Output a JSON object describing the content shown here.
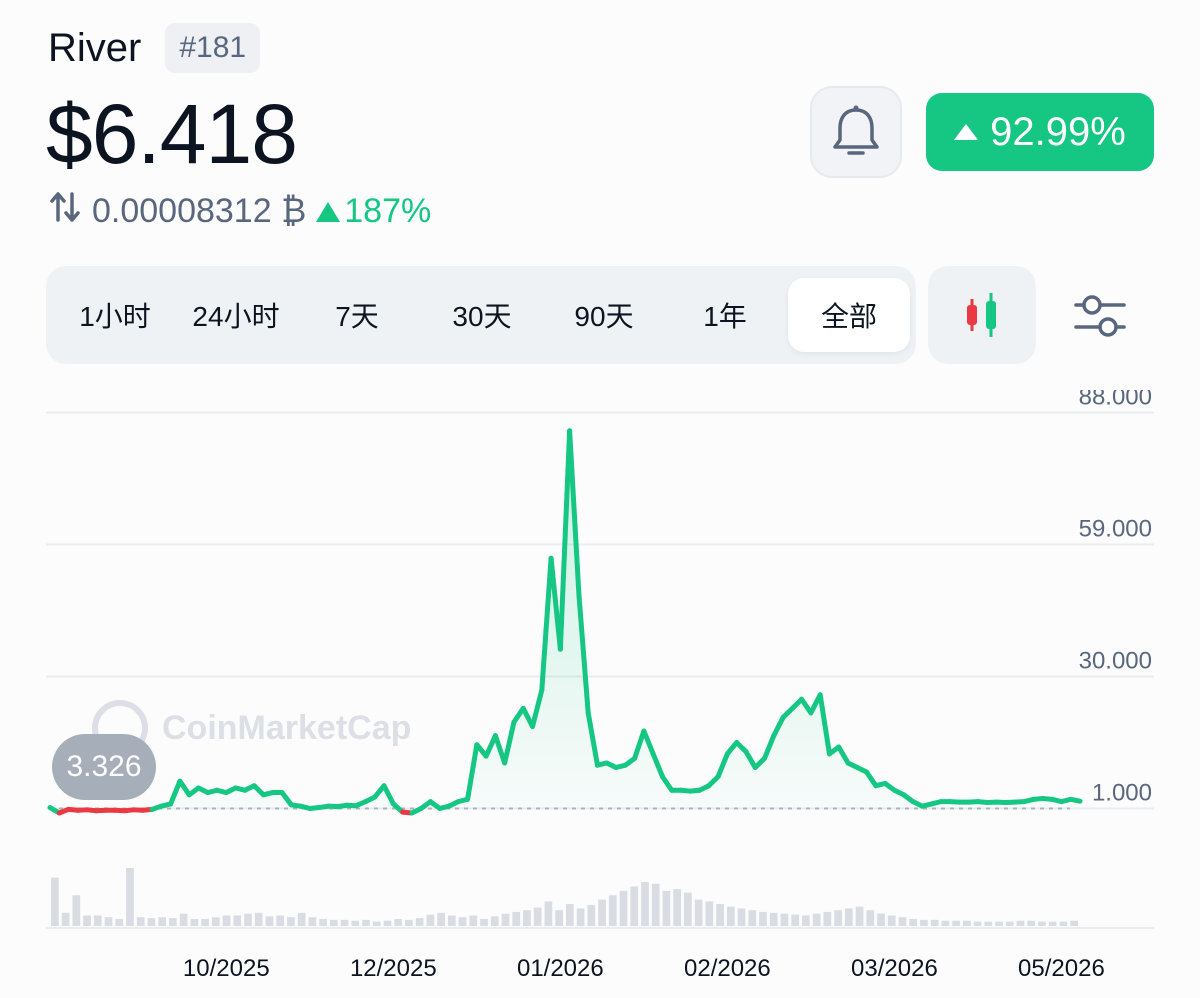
{
  "coin": {
    "name": "River",
    "rank": "#181"
  },
  "price": "$6.418",
  "btc": {
    "value": "0.00008312 ₿",
    "change": "187%"
  },
  "change_24h": "92.99%",
  "tabs": [
    {
      "label": "1小时",
      "active": false
    },
    {
      "label": "24小时",
      "active": false
    },
    {
      "label": "7天",
      "active": false
    },
    {
      "label": "30天",
      "active": false
    },
    {
      "label": "90天",
      "active": false
    },
    {
      "label": "1年",
      "active": false
    },
    {
      "label": "全部",
      "active": true
    }
  ],
  "watermark": "CoinMarketCap",
  "start_value": "3.326",
  "colors": {
    "up": "#16c784",
    "down": "#ea3943",
    "text": "#0d1421",
    "muted": "#58667e"
  },
  "chart_data": {
    "type": "line",
    "y_ticks": [
      "88.000",
      "59.000",
      "30.000",
      "1.000"
    ],
    "y_tick_values": [
      88,
      59,
      30,
      1
    ],
    "x_ticks": [
      "10/2025",
      "12/2025",
      "01/2026",
      "02/2026",
      "03/2026",
      "05/2026"
    ],
    "x_tick_index": [
      19,
      37,
      55,
      73,
      91,
      109
    ],
    "baseline": 1,
    "start_label": "3.326",
    "grid": true,
    "values": [
      1.2,
      0.0,
      0.8,
      0.6,
      0.7,
      0.5,
      0.6,
      0.6,
      0.5,
      0.7,
      0.6,
      0.8,
      1.5,
      2.0,
      7.0,
      4.0,
      5.5,
      4.5,
      5.0,
      4.5,
      5.5,
      5.0,
      6.0,
      4.0,
      4.5,
      4.5,
      1.8,
      1.5,
      1.0,
      1.2,
      1.5,
      1.4,
      1.7,
      1.6,
      2.5,
      3.5,
      6.0,
      2.0,
      0.2,
      0.0,
      1.0,
      2.5,
      1.0,
      1.5,
      2.5,
      3.0,
      15.0,
      12.5,
      17.0,
      11.0,
      20.0,
      23.0,
      19.0,
      27.0,
      56.0,
      36.0,
      84.0,
      48.0,
      22.0,
      10.5,
      11.0,
      10.0,
      10.5,
      12.0,
      18.0,
      13.0,
      8.0,
      5.0,
      5.0,
      4.8,
      5.0,
      6.0,
      8.0,
      13.0,
      15.5,
      13.5,
      10.0,
      12.0,
      17.0,
      21.0,
      23.0,
      25.0,
      22.0,
      26.0,
      13.0,
      14.5,
      11.0,
      10.0,
      9.0,
      6.0,
      6.5,
      5.0,
      4.0,
      2.5,
      1.5,
      2.0,
      2.5,
      2.5,
      2.4,
      2.4,
      2.5,
      2.3,
      2.4,
      2.3,
      2.4,
      2.5,
      3.0,
      3.2,
      3.0,
      2.5,
      3.0,
      2.6
    ],
    "volume": [
      55,
      15,
      35,
      12,
      12,
      10,
      8,
      66,
      10,
      9,
      10,
      9,
      14,
      8,
      8,
      10,
      12,
      12,
      14,
      15,
      11,
      12,
      10,
      15,
      10,
      8,
      7,
      7,
      6,
      7,
      5,
      6,
      8,
      7,
      9,
      13,
      15,
      12,
      10,
      12,
      8,
      11,
      14,
      16,
      18,
      21,
      28,
      18,
      25,
      20,
      24,
      30,
      35,
      40,
      45,
      50,
      48,
      40,
      42,
      38,
      30,
      28,
      25,
      22,
      20,
      18,
      16,
      15,
      14,
      13,
      12,
      14,
      16,
      18,
      20,
      22,
      18,
      14,
      12,
      10,
      8,
      7,
      7,
      6,
      6,
      6,
      5,
      5,
      5,
      5,
      6,
      6,
      5,
      5,
      5,
      6
    ]
  }
}
